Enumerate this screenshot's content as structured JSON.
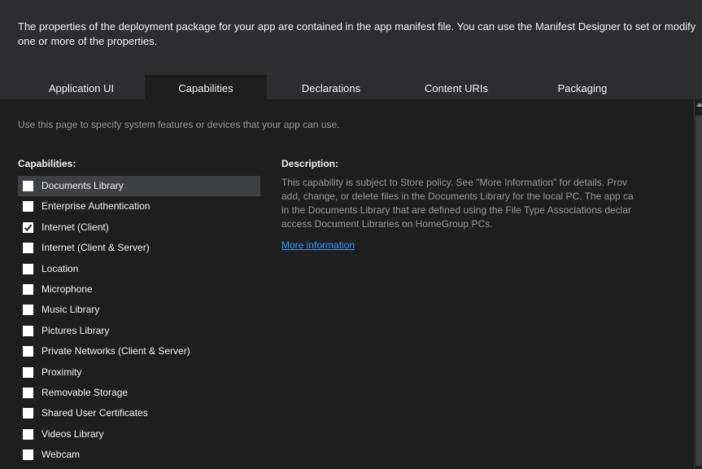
{
  "header": {
    "description": "The properties of the deployment package for your app are contained in the app manifest file. You can use the Manifest Designer to set or modify one or more of the properties."
  },
  "tabs": [
    {
      "label": "Application UI",
      "active": false
    },
    {
      "label": "Capabilities",
      "active": true
    },
    {
      "label": "Declarations",
      "active": false
    },
    {
      "label": "Content URIs",
      "active": false
    },
    {
      "label": "Packaging",
      "active": false
    }
  ],
  "page": {
    "intro": "Use this page to specify system features or devices that your app can use."
  },
  "capabilities": {
    "heading": "Capabilities:",
    "items": [
      {
        "label": "Documents Library",
        "checked": false,
        "selected": true
      },
      {
        "label": "Enterprise Authentication",
        "checked": false,
        "selected": false
      },
      {
        "label": "Internet (Client)",
        "checked": true,
        "selected": false
      },
      {
        "label": "Internet (Client & Server)",
        "checked": false,
        "selected": false
      },
      {
        "label": "Location",
        "checked": false,
        "selected": false
      },
      {
        "label": "Microphone",
        "checked": false,
        "selected": false
      },
      {
        "label": "Music Library",
        "checked": false,
        "selected": false
      },
      {
        "label": "Pictures Library",
        "checked": false,
        "selected": false
      },
      {
        "label": "Private Networks (Client & Server)",
        "checked": false,
        "selected": false
      },
      {
        "label": "Proximity",
        "checked": false,
        "selected": false
      },
      {
        "label": "Removable Storage",
        "checked": false,
        "selected": false
      },
      {
        "label": "Shared User Certificates",
        "checked": false,
        "selected": false
      },
      {
        "label": "Videos Library",
        "checked": false,
        "selected": false
      },
      {
        "label": "Webcam",
        "checked": false,
        "selected": false
      }
    ]
  },
  "description": {
    "heading": "Description:",
    "lines": [
      "This capability is subject to Store policy. See \"More Information\" for details. Prov",
      "add, change, or delete files in the Documents Library for the local PC. The app ca",
      "in the Documents Library that are defined using the File Type Associations declar",
      "access Document Libraries on HomeGroup PCs."
    ],
    "link": "More information"
  },
  "colors": {
    "background": "#1e1e1e",
    "header_background": "#2d2d30",
    "selected_row": "#3f3f46",
    "link": "#3399ff",
    "muted_text": "#999999"
  },
  "icons": {
    "checkbox_checked": "checkmark-icon",
    "scrollbar_up": "scroll-up-arrow-icon"
  }
}
